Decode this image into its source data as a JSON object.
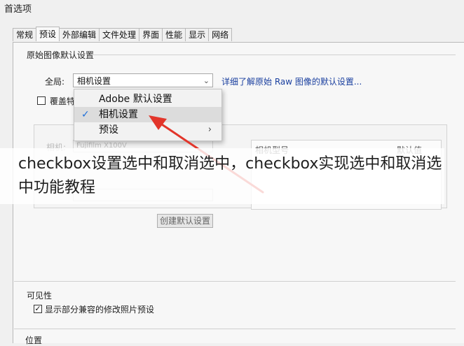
{
  "window": {
    "title": "首选项"
  },
  "tabs": [
    "常规",
    "预设",
    "外部编辑",
    "文件处理",
    "界面",
    "性能",
    "显示",
    "网络"
  ],
  "active_tab_index": 1,
  "raw_defaults": {
    "group_title": "原始图像默认设置",
    "global_label": "全局:",
    "global_value": "相机设置",
    "details_link": "详细了解原始 Raw 图像的默认设置...",
    "override_label": "覆盖特",
    "dropdown_items": [
      {
        "label": "Adobe 默认设置",
        "checked": false,
        "submenu": false
      },
      {
        "label": "相机设置",
        "checked": true,
        "submenu": false
      },
      {
        "label": "预设",
        "checked": false,
        "submenu": true
      }
    ],
    "camera_label": "相机:",
    "camera_value": "Fujifilm X100V",
    "table_col_model": "相机型号",
    "table_col_default": "默认值",
    "create_default_button": "创建默认设置"
  },
  "visibility": {
    "group_title": "可见性",
    "show_checkbox_label": "显示部分兼容的修改照片预设",
    "show_checked": true
  },
  "location": {
    "group_title": "位置"
  },
  "overlay_caption": "checkbox设置选中和取消选中，checkbox实现选中和取消选中功能教程",
  "colors": {
    "link": "#1a3f9f",
    "arrow": "#e2352a",
    "check": "#1e6fd9"
  }
}
